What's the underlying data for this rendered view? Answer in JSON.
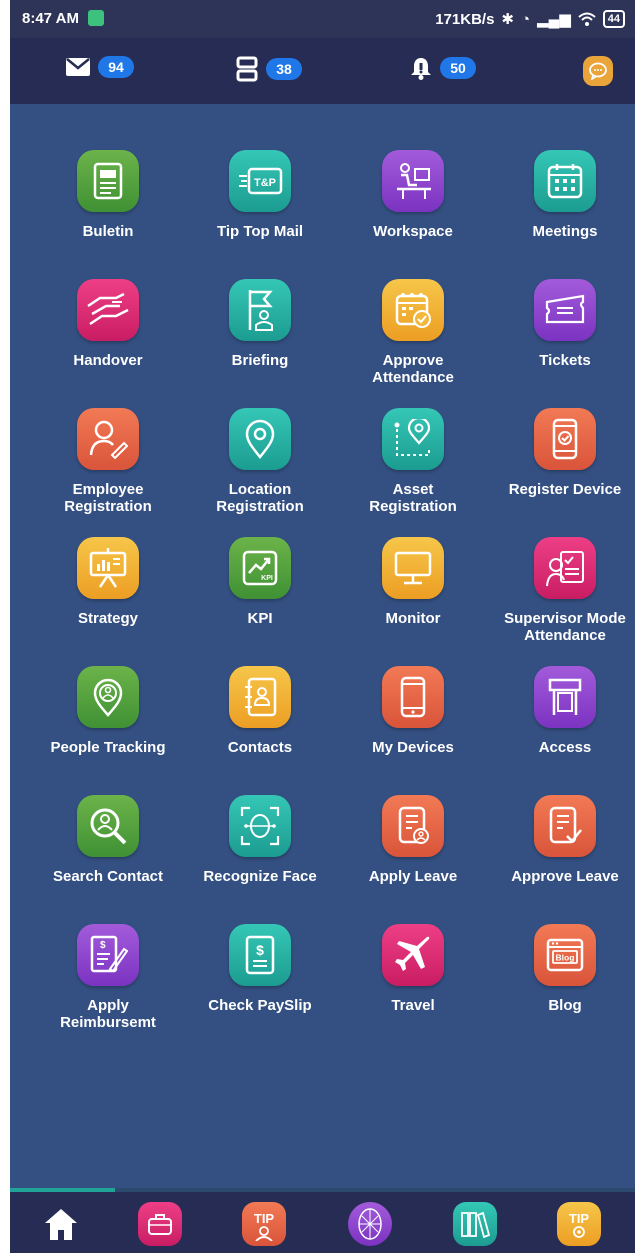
{
  "status_bar": {
    "time": "8:47 AM",
    "network_speed": "171KB/s",
    "battery": "44"
  },
  "top_nav": {
    "mail_count": "94",
    "tasks_count": "38",
    "notifications_count": "50"
  },
  "apps": [
    {
      "label": "Buletin",
      "icon": "newspaper-icon"
    },
    {
      "label": "Tip Top Mail",
      "icon": "mail-brand-icon",
      "icon_text": "T&P"
    },
    {
      "label": "Workspace",
      "icon": "desk-worker-icon"
    },
    {
      "label": "Meetings",
      "icon": "calendar-icon"
    },
    {
      "label": "Handover",
      "icon": "handshake-icon"
    },
    {
      "label": "Briefing",
      "icon": "flag-person-icon"
    },
    {
      "label": "Approve\nAttendance",
      "icon": "calendar-check-icon"
    },
    {
      "label": "Tickets",
      "icon": "ticket-icon"
    },
    {
      "label": "Employee\nRegistration",
      "icon": "user-edit-icon"
    },
    {
      "label": "Location\nRegistration",
      "icon": "location-pin-icon"
    },
    {
      "label": "Asset\nRegistration",
      "icon": "route-pin-icon"
    },
    {
      "label": "Register Device",
      "icon": "phone-check-icon"
    },
    {
      "label": "Strategy",
      "icon": "presentation-board-icon"
    },
    {
      "label": "KPI",
      "icon": "kpi-chart-icon",
      "icon_text": "KPI"
    },
    {
      "label": "Monitor",
      "icon": "monitor-icon"
    },
    {
      "label": "Supervisor Mode\nAttendance",
      "icon": "supervisor-clipboard-icon"
    },
    {
      "label": "People Tracking",
      "icon": "person-pin-icon"
    },
    {
      "label": "Contacts",
      "icon": "contact-book-icon"
    },
    {
      "label": "My Devices",
      "icon": "mobile-device-icon"
    },
    {
      "label": "Access",
      "icon": "door-gate-icon"
    },
    {
      "label": "Search Contact",
      "icon": "search-person-icon"
    },
    {
      "label": "Recognize Face",
      "icon": "face-scan-icon"
    },
    {
      "label": "Apply Leave",
      "icon": "document-user-icon"
    },
    {
      "label": "Approve Leave",
      "icon": "document-check-icon"
    },
    {
      "label": "Apply\nReimbursemt",
      "icon": "invoice-sign-icon"
    },
    {
      "label": "Check PaySlip",
      "icon": "payslip-icon"
    },
    {
      "label": "Travel",
      "icon": "airplane-icon"
    },
    {
      "label": "Blog",
      "icon": "blog-window-icon",
      "icon_text": "Blog"
    }
  ],
  "bottom_nav": {
    "tip_text": "TIP"
  },
  "colors": {
    "background": "#345082",
    "nav_bar": "#262c53",
    "badge": "#1f77e8",
    "green": "#4fa13c",
    "teal": "#25b0a3",
    "purple": "#8e44cf",
    "pink": "#e02c74",
    "orange": "#f0ae30",
    "coral": "#e4623f"
  }
}
